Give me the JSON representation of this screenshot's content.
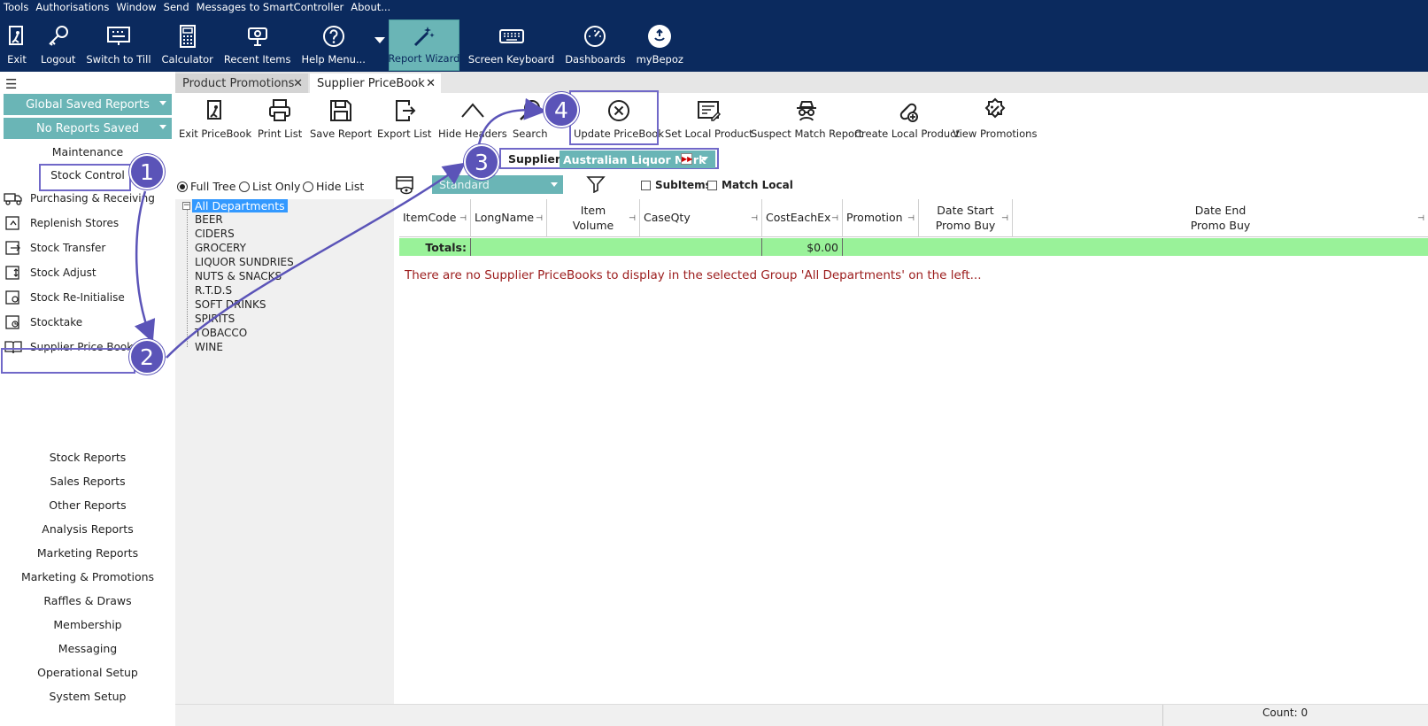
{
  "menubar": [
    "Tools",
    "Authorisations",
    "Window",
    "Send",
    "Messages to SmartController",
    "About..."
  ],
  "main_toolbar": [
    {
      "label": "Exit",
      "icon": "exit-icon"
    },
    {
      "label": "Logout",
      "icon": "key-icon"
    },
    {
      "label": "Switch to Till",
      "icon": "till-icon"
    },
    {
      "label": "Calculator",
      "icon": "calculator-icon"
    },
    {
      "label": "Recent Items",
      "icon": "recent-items-icon"
    },
    {
      "label": "Help Menu...",
      "icon": "help-icon"
    },
    {
      "label": "Report Wizard",
      "icon": "wand-icon"
    },
    {
      "label": "Screen Keyboard",
      "icon": "keyboard-icon"
    },
    {
      "label": "Dashboards",
      "icon": "gauge-icon"
    },
    {
      "label": "myBepoz",
      "icon": "mybepoz-icon"
    }
  ],
  "sidebar": {
    "global_saved_reports": "Global Saved Reports",
    "no_reports_saved": "No Reports Saved",
    "maintenance": "Maintenance",
    "stock_control": "Stock Control",
    "items": [
      "Purchasing & Receiving",
      "Replenish Stores",
      "Stock Transfer",
      "Stock Adjust",
      "Stock Re-Initialise",
      "Stocktake",
      "Supplier Price Book"
    ],
    "bottom": [
      "Stock Reports",
      "Sales Reports",
      "Other Reports",
      "Analysis Reports",
      "Marketing Reports",
      "Marketing & Promotions",
      "Raffles & Draws",
      "Membership",
      "Messaging",
      "Operational Setup",
      "System Setup"
    ]
  },
  "tabs": [
    {
      "label": "Product Promotions",
      "close": "✕"
    },
    {
      "label": "Supplier PriceBook",
      "close": "✕"
    }
  ],
  "content_toolbar": [
    {
      "label": "Exit PriceBook"
    },
    {
      "label": "Print List"
    },
    {
      "label": "Save Report"
    },
    {
      "label": "Export List"
    },
    {
      "label": "Hide Headers"
    },
    {
      "label": "Search"
    },
    {
      "label": "Update PriceBook"
    },
    {
      "label": "Set Local Product"
    },
    {
      "label": "Suspect Match Report"
    },
    {
      "label": "Create Local Product"
    },
    {
      "label": "View Promotions"
    }
  ],
  "supplier": {
    "label": "Supplier:",
    "value": "Australian Liquor Mark"
  },
  "view_options": {
    "full_tree": "Full Tree",
    "list_only": "List Only",
    "hide_list": "Hide List",
    "selected": "full_tree"
  },
  "layout_dropdown": "Standard",
  "checkboxes": {
    "subitems": "SubItems",
    "match_local": "Match Local"
  },
  "tree": {
    "root": "All Departments",
    "children": [
      "BEER",
      "CIDERS",
      "GROCERY",
      "LIQUOR SUNDRIES",
      "NUTS & SNACKS",
      "R.T.D.S",
      "SOFT DRINKS",
      "SPIRITS",
      "TOBACCO",
      "WINE"
    ]
  },
  "grid": {
    "columns": [
      "ItemCode",
      "LongName",
      "Item\nVolume",
      "CaseQty",
      "CostEachEx",
      "Promotion",
      "Date Start\nPromo Buy",
      "Date End\nPromo Buy"
    ],
    "totals_label": "Totals:",
    "totals_cost": "$0.00",
    "empty_message": "There are no Supplier PriceBooks to display in the selected Group 'All Departments' on the left..."
  },
  "status": {
    "count": "Count: 0"
  },
  "annotations": [
    "1",
    "2",
    "3",
    "4"
  ],
  "colors": {
    "navy": "#0b2a5e",
    "teal": "#6ab5b6",
    "annotation": "#5b54b8",
    "totals": "#99f299",
    "error_text": "#9b1b1b"
  }
}
